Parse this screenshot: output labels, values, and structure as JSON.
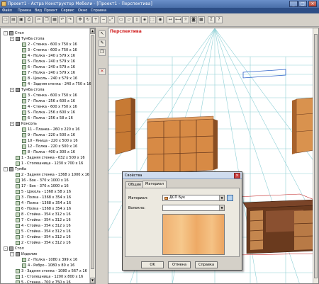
{
  "window": {
    "title": "Проект1 - Астра Конструктор Мебели - [Проект1 - Перспектива]",
    "buttons": [
      "_",
      "□",
      "×"
    ]
  },
  "menu": [
    "Файл",
    "Правка",
    "Вид",
    "Проект",
    "Сервис",
    "Окно",
    "Справка"
  ],
  "toolbar": {
    "icons": [
      "new-file-icon",
      "open-icon",
      "save-icon",
      "print-icon",
      "cut-icon",
      "copy-icon",
      "paste-icon",
      "undo-icon",
      "redo-icon",
      "move-icon",
      "rotate-icon",
      "zoom-in-icon",
      "zoom-out-icon",
      "zoom-fit-icon",
      "view-front-icon",
      "view-top-icon",
      "view-side-icon",
      "view-3d-icon",
      "wireframe-icon",
      "render-icon",
      "measure-icon",
      "dimension-icon",
      "lamp-icon",
      "camera-icon",
      "material-icon",
      "sum-icon",
      "help-icon"
    ]
  },
  "tree": {
    "rows": [
      {
        "level": 0,
        "exp": "-",
        "icon": "folder",
        "label": "Стол"
      },
      {
        "level": 1,
        "exp": "-",
        "icon": "folder",
        "label": "Тумба стола"
      },
      {
        "level": 2,
        "exp": "",
        "icon": "part",
        "label": "2 - Стенка - 600 x 750 x 16"
      },
      {
        "level": 2,
        "exp": "",
        "icon": "part",
        "label": "3 - Стенка - 600 x 750 x 16"
      },
      {
        "level": 2,
        "exp": "",
        "icon": "part",
        "label": "4 - Полка - 240 x 579 x 16"
      },
      {
        "level": 2,
        "exp": "",
        "icon": "part",
        "label": "5 - Полка - 240 x 579 x 16"
      },
      {
        "level": 2,
        "exp": "",
        "icon": "part",
        "label": "6 - Полка - 240 x 579 x 16"
      },
      {
        "level": 2,
        "exp": "",
        "icon": "part",
        "label": "7 - Полка - 240 x 579 x 16"
      },
      {
        "level": 2,
        "exp": "",
        "icon": "part",
        "label": "8 - Цоколь - 240 x 579 x 16"
      },
      {
        "level": 2,
        "exp": "",
        "icon": "part",
        "label": "4 - Задняя стенка - 240 x 750 x 16"
      },
      {
        "level": 1,
        "exp": "-",
        "icon": "folder",
        "label": "Тумба стола"
      },
      {
        "level": 2,
        "exp": "",
        "icon": "part",
        "label": "3 - Стенка - 600 x 750 x 16"
      },
      {
        "level": 2,
        "exp": "",
        "icon": "part",
        "label": "7 - Полка - 256 x 600 x 16"
      },
      {
        "level": 2,
        "exp": "",
        "icon": "part",
        "label": "4 - Стенка - 600 x 750 x 16"
      },
      {
        "level": 2,
        "exp": "",
        "icon": "part",
        "label": "5 - Полка - 256 x 600 x 16"
      },
      {
        "level": 2,
        "exp": "",
        "icon": "part",
        "label": "6 - Полка - 256 x 58 x 16"
      },
      {
        "level": 1,
        "exp": "-",
        "icon": "folder",
        "label": "Консоль"
      },
      {
        "level": 2,
        "exp": "",
        "icon": "part",
        "label": "11 - Планка - 260 x 220 x 16"
      },
      {
        "level": 2,
        "exp": "",
        "icon": "part",
        "label": "9 - Полка - 220 x 500 x 16"
      },
      {
        "level": 2,
        "exp": "",
        "icon": "part",
        "label": "10 - Кница - 220 x 500 x 16"
      },
      {
        "level": 2,
        "exp": "",
        "icon": "part",
        "label": "12 - Полка - 220 x 500 x 16"
      },
      {
        "level": 2,
        "exp": "",
        "icon": "part",
        "label": "8 - Полка - 400 x 300 x 16"
      },
      {
        "level": 1,
        "exp": "",
        "icon": "part",
        "label": "1 - Задняя стенка - 632 x 500 x 16"
      },
      {
        "level": 1,
        "exp": "",
        "icon": "part",
        "label": "1 - Столешница - 1230 x 700 x 16"
      },
      {
        "level": 0,
        "exp": "-",
        "icon": "folder",
        "label": "Тумба"
      },
      {
        "level": 1,
        "exp": "",
        "icon": "part",
        "label": "2 - Задняя стенка - 1368 x 1000 x 16"
      },
      {
        "level": 1,
        "exp": "",
        "icon": "part",
        "label": "16 - Бок - 370 x 1000 x 16"
      },
      {
        "level": 1,
        "exp": "",
        "icon": "part",
        "label": "17 - Бок - 370 x 1000 x 16"
      },
      {
        "level": 1,
        "exp": "",
        "icon": "part",
        "label": "5 - Цоколь - 1368 x 58 x 16"
      },
      {
        "level": 1,
        "exp": "",
        "icon": "part",
        "label": "3 - Полка - 1368 x 354 x 16"
      },
      {
        "level": 1,
        "exp": "",
        "icon": "part",
        "label": "4 - Полка - 1368 x 354 x 16"
      },
      {
        "level": 1,
        "exp": "",
        "icon": "part",
        "label": "6 - Полка - 1368 x 354 x 16"
      },
      {
        "level": 1,
        "exp": "",
        "icon": "part",
        "label": "8 - Стойка - 354 x 312 x 16"
      },
      {
        "level": 1,
        "exp": "",
        "icon": "part",
        "label": "7 - Стойка - 354 x 312 x 16"
      },
      {
        "level": 1,
        "exp": "",
        "icon": "part",
        "label": "4 - Стойка - 354 x 312 x 16"
      },
      {
        "level": 1,
        "exp": "",
        "icon": "part",
        "label": "5 - Стойка - 354 x 312 x 16"
      },
      {
        "level": 1,
        "exp": "",
        "icon": "part",
        "label": "3 - Стойка - 354 x 312 x 16"
      },
      {
        "level": 1,
        "exp": "",
        "icon": "part",
        "label": "2 - Стойка - 354 x 312 x 16"
      },
      {
        "level": 0,
        "exp": "-",
        "icon": "folder",
        "label": "Стол"
      },
      {
        "level": 1,
        "exp": "-",
        "icon": "folder",
        "label": "Изделие"
      },
      {
        "level": 2,
        "exp": "",
        "icon": "part",
        "label": "2 - Полка - 1080 x 399 x 16"
      },
      {
        "level": 2,
        "exp": "",
        "icon": "part",
        "label": "4 - Ребро - 1080 x 80 x 16"
      },
      {
        "level": 1,
        "exp": "",
        "icon": "part",
        "label": "3 - Задняя стенка - 1080 x 567 x 16"
      },
      {
        "level": 1,
        "exp": "",
        "icon": "part",
        "label": "1 - Столешница - 1200 x 800 x 16"
      },
      {
        "level": 1,
        "exp": "",
        "icon": "part",
        "label": "5 - Стенка - 700 x 750 x 16"
      }
    ]
  },
  "side_tools": [
    "select-icon",
    "pencil-icon",
    "copy-icon",
    "delete-icon"
  ],
  "viewport": {
    "label": "Перспектива"
  },
  "dialog": {
    "title": "Свойства",
    "close": "×",
    "tabs": [
      "Общие",
      "Материал"
    ],
    "active_tab": "Материал",
    "material_label": "Материал:",
    "material_value": "ДСП Бук",
    "texture_label": "Волокна:",
    "texture_value": "",
    "ok": "OK",
    "cancel": "Отмена",
    "apply": "Справка"
  },
  "colors": {
    "wood": "#e8a255",
    "wood_dark": "#b86e2c",
    "dark_wood": "#6a3a1e",
    "grid": "#8fd0d6",
    "accent": "#2d4e86"
  }
}
